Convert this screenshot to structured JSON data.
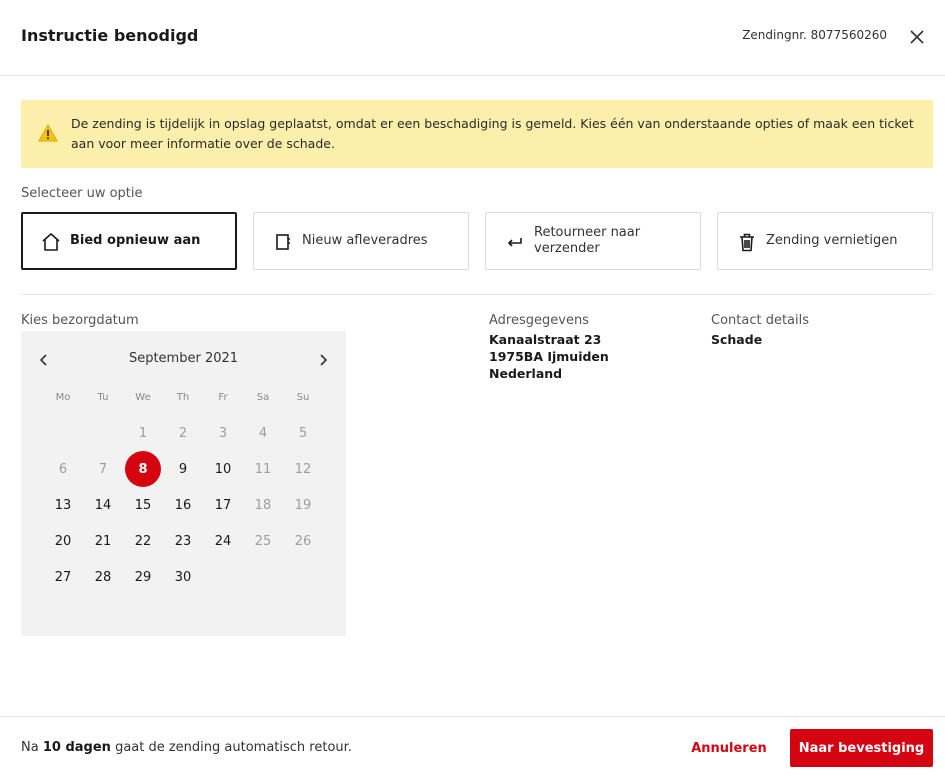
{
  "header": {
    "title": "Instructie benodigd",
    "shipment_label": "Zendingnr. 8077560260",
    "close_icon": "close-icon"
  },
  "alert": {
    "icon": "warning-icon",
    "text": "De zending is tijdelijk in opslag geplaatst, omdat er een beschadiging is gemeld. Kies één van onderstaande opties of maak een ticket aan voor meer informatie over de schade.",
    "background_color": "#fcefab"
  },
  "options": {
    "label": "Selecteer uw optie",
    "items": [
      {
        "label": "Bied opnieuw aan",
        "icon": "home-icon",
        "selected": true
      },
      {
        "label": "Nieuw afleveradres",
        "icon": "address-book-icon",
        "selected": false
      },
      {
        "label": "Retourneer naar verzender",
        "icon": "return-arrow-icon",
        "selected": false
      },
      {
        "label": "Zending vernietigen",
        "icon": "trash-icon",
        "selected": false
      }
    ]
  },
  "calendar": {
    "label": "Kies bezorgdatum",
    "month": "September 2021",
    "weekdays": [
      "Mo",
      "Tu",
      "We",
      "Th",
      "Fr",
      "Sa",
      "Su"
    ],
    "weeks": [
      [
        null,
        null,
        1,
        2,
        3,
        4,
        5
      ],
      [
        6,
        7,
        8,
        9,
        10,
        11,
        12
      ],
      [
        13,
        14,
        15,
        16,
        17,
        18,
        19
      ],
      [
        20,
        21,
        22,
        23,
        24,
        25,
        26
      ],
      [
        27,
        28,
        29,
        30,
        null,
        null,
        null
      ]
    ],
    "disabled_days": [
      1,
      2,
      3,
      4,
      5,
      6,
      7,
      11,
      12,
      18,
      19,
      25,
      26
    ],
    "selected_day": 8
  },
  "address": {
    "label": "Adresgegevens",
    "line1": "Kanaalstraat 23",
    "line2": "1975BA Ijmuiden",
    "line3": "Nederland"
  },
  "contact": {
    "label": "Contact details",
    "value": "Schade"
  },
  "footer": {
    "note_prefix": "Na",
    "note_bold": "10 dagen",
    "note_suffix": "gaat de zending automatisch retour.",
    "cancel_label": "Annuleren",
    "confirm_label": "Naar bevestiging",
    "accent_color": "#d40511"
  }
}
